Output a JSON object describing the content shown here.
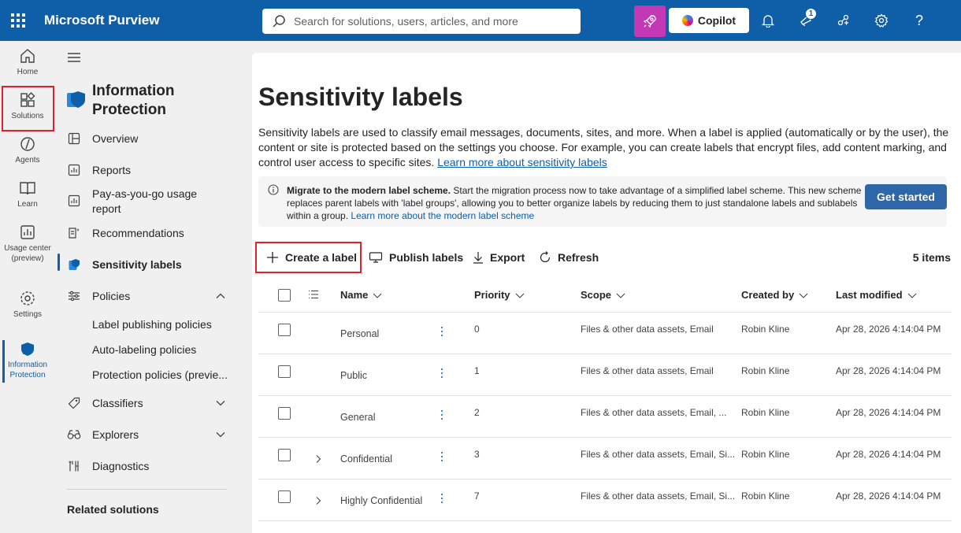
{
  "topbar": {
    "brand": "Microsoft Purview",
    "search_placeholder": "Search for solutions, users, articles, and more",
    "copilot_label": "Copilot",
    "notification_badge": "1",
    "help_label": "?"
  },
  "rail": {
    "items": [
      {
        "label": "Home"
      },
      {
        "label": "Solutions"
      },
      {
        "label": "Agents"
      },
      {
        "label": "Learn"
      },
      {
        "label": "Usage center (preview)"
      },
      {
        "label": "Settings"
      },
      {
        "label": "Information Protection"
      }
    ]
  },
  "nav": {
    "title": "Information Protection",
    "items": {
      "overview": "Overview",
      "reports": "Reports",
      "payg": "Pay-as-you-go usage report",
      "recommendations": "Recommendations",
      "sensitivity_labels": "Sensitivity labels",
      "policies": "Policies",
      "label_publishing": "Label publishing policies",
      "auto_labeling": "Auto-labeling policies",
      "protection_policies": "Protection policies (previe...",
      "classifiers": "Classifiers",
      "explorers": "Explorers",
      "diagnostics": "Diagnostics",
      "related": "Related solutions"
    }
  },
  "main": {
    "title": "Sensitivity labels",
    "description": "Sensitivity labels are used to classify email messages, documents, sites, and more. When a label is applied (automatically or by the user), the content or site is protected based on the settings you choose. For example, you can create labels that encrypt files, add content marking, and control user access to specific sites.",
    "learn_more": "Learn more about sensitivity labels",
    "banner": {
      "bold": "Migrate to the modern label scheme.",
      "text": "Start the migration process now to take advantage of a simplified label scheme. This new scheme replaces parent labels with 'label groups', allowing you to better organize labels by reducing them to just standalone labels and sublabels within a group.",
      "link": "Learn more about the modern label scheme",
      "button": "Get started"
    },
    "toolbar": {
      "create": "Create a label",
      "publish": "Publish labels",
      "export": "Export",
      "refresh": "Refresh",
      "count": "5 items"
    },
    "table": {
      "headers": {
        "name": "Name",
        "priority": "Priority",
        "scope": "Scope",
        "created_by": "Created by",
        "last_modified": "Last modified"
      },
      "rows": [
        {
          "name": "Personal",
          "priority": "0",
          "scope": "Files & other data assets, Email",
          "created_by": "Robin Kline",
          "last_modified": "Apr 28, 2026 4:14:04 PM",
          "expandable": false
        },
        {
          "name": "Public",
          "priority": "1",
          "scope": "Files & other data assets, Email",
          "created_by": "Robin Kline",
          "last_modified": "Apr 28, 2026 4:14:04 PM",
          "expandable": false
        },
        {
          "name": "General",
          "priority": "2",
          "scope": "Files & other data assets, Email, ...",
          "created_by": "Robin Kline",
          "last_modified": "Apr 28, 2026 4:14:04 PM",
          "expandable": false
        },
        {
          "name": "Confidential",
          "priority": "3",
          "scope": "Files & other data assets, Email, Si...",
          "created_by": "Robin Kline",
          "last_modified": "Apr 28, 2026 4:14:04 PM",
          "expandable": true
        },
        {
          "name": "Highly Confidential",
          "priority": "7",
          "scope": "Files & other data assets, Email, Si...",
          "created_by": "Robin Kline",
          "last_modified": "Apr 28, 2026 4:14:04 PM",
          "expandable": true
        }
      ]
    }
  }
}
